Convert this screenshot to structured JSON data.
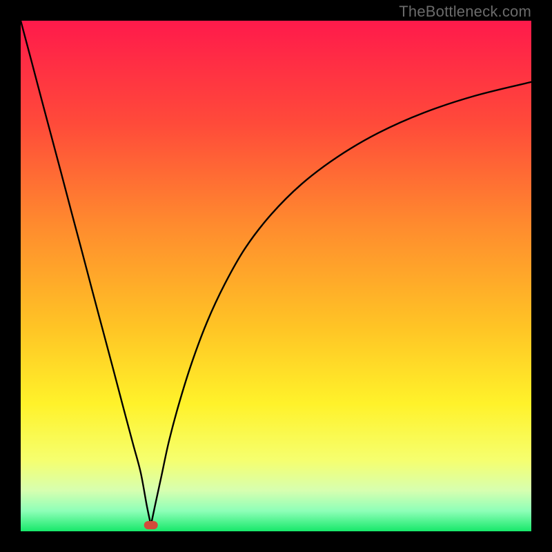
{
  "watermark": "TheBottleneck.com",
  "chart_data": {
    "type": "line",
    "title": "",
    "xlabel": "",
    "ylabel": "",
    "xlim": [
      0,
      100
    ],
    "ylim": [
      0,
      100
    ],
    "grid": false,
    "legend": false,
    "background_gradient": {
      "stops": [
        {
          "offset": 0.0,
          "color": "#ff1a4b"
        },
        {
          "offset": 0.2,
          "color": "#ff4a3a"
        },
        {
          "offset": 0.4,
          "color": "#ff8b2e"
        },
        {
          "offset": 0.6,
          "color": "#ffc425"
        },
        {
          "offset": 0.75,
          "color": "#fff22a"
        },
        {
          "offset": 0.86,
          "color": "#f6ff6e"
        },
        {
          "offset": 0.92,
          "color": "#d7ffb0"
        },
        {
          "offset": 0.96,
          "color": "#8effb8"
        },
        {
          "offset": 1.0,
          "color": "#17e86a"
        }
      ]
    },
    "marker": {
      "x": 25.5,
      "y": 1.2,
      "color": "#d24a3a"
    },
    "series": [
      {
        "name": "left-branch",
        "x": [
          0.0,
          2.0,
          4.0,
          6.0,
          8.0,
          10.0,
          12.0,
          14.0,
          16.0,
          18.0,
          20.0,
          22.0,
          23.5,
          24.7,
          25.5
        ],
        "y": [
          100.0,
          92.5,
          84.9,
          77.4,
          69.9,
          62.3,
          54.8,
          47.2,
          39.7,
          32.2,
          24.6,
          17.1,
          11.5,
          5.0,
          1.2
        ]
      },
      {
        "name": "right-branch",
        "x": [
          25.5,
          26.3,
          27.6,
          29.0,
          31.0,
          33.5,
          36.5,
          40.0,
          44.0,
          49.0,
          55.0,
          62.0,
          70.0,
          79.0,
          89.0,
          100.0
        ],
        "y": [
          1.2,
          5.0,
          11.0,
          17.5,
          25.0,
          33.0,
          41.0,
          48.5,
          55.5,
          62.0,
          68.0,
          73.3,
          78.0,
          82.0,
          85.3,
          88.0
        ]
      }
    ]
  }
}
